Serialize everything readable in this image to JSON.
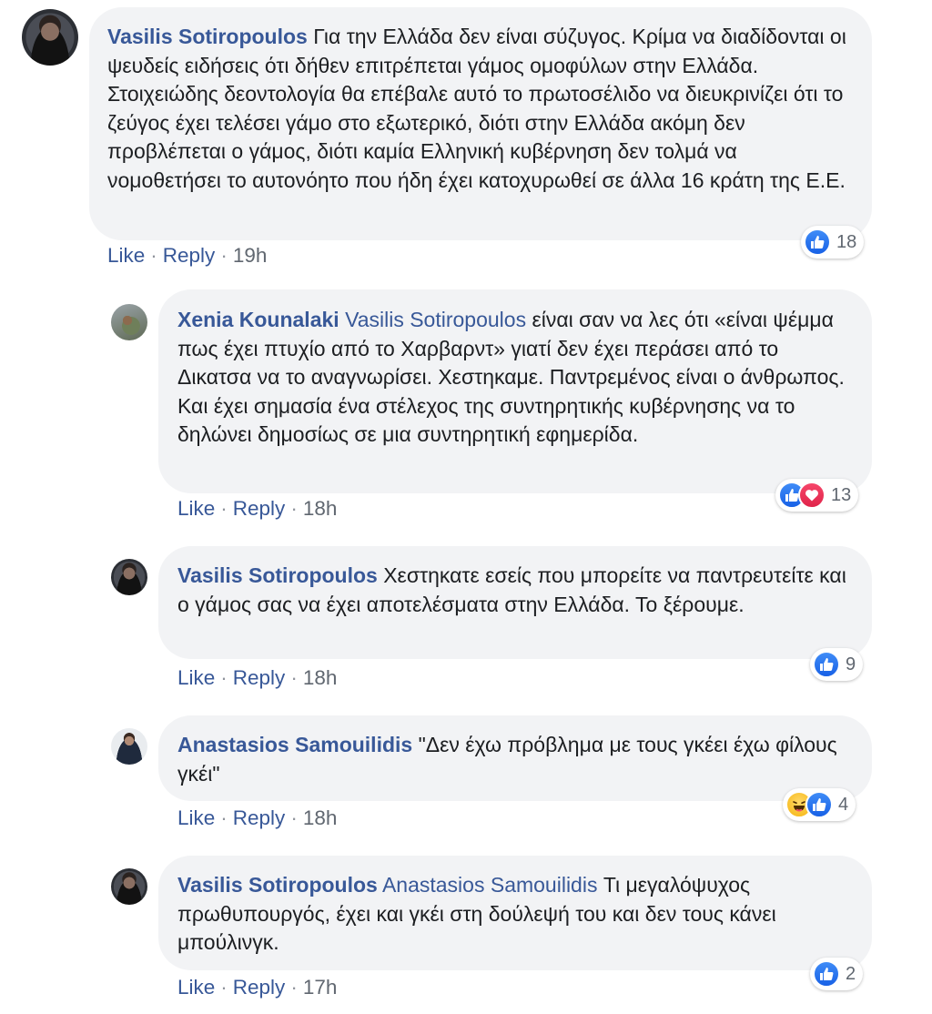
{
  "comments": [
    {
      "author": "Vasilis Sotiropoulos",
      "mention": "",
      "text": "Για την Ελλάδα δεν είναι σύζυγος. Κρίμα να διαδίδονται οι ψευδείς ειδήσεις ότι δήθεν επιτρέπεται γάμος ομοφύλων στην Ελλάδα. Στοιχειώδης δεοντολογία θα επέβαλε αυτό το πρωτοσέλιδο να διευκρινίζει ότι το ζεύγος έχει τελέσει γάμο στο εξωτερικό, διότι στην Ελλάδα ακόμη δεν προβλέπεται ο γάμος, διότι καμία Ελληνική κυβέρνηση δεν τολμά να νομοθετήσει το αυτονόητο που ήδη έχει κατοχυρωθεί σε άλλα 16 κράτη της Ε.Ε.",
      "like_label": "Like",
      "reply_label": "Reply",
      "time": "19h",
      "reactions": [
        "like"
      ],
      "reaction_count": "18"
    },
    {
      "author": "Xenia Kounalaki",
      "mention": "Vasilis Sotiropoulos",
      "text": "είναι σαν να λες ότι «είναι ψέμμα πως έχει πτυχίο από το Χαρβαρντ» γιατί δεν έχει περάσει από το Δικατσα να το αναγνωρίσει. Χεστηκαμε. Παντρεμένος είναι ο άνθρωπος. Και έχει σημασία ένα στέλεχος της συντηρητικής κυβέρνησης να το δηλώνει δημοσίως σε μια συντηρητική εφημερίδα.",
      "like_label": "Like",
      "reply_label": "Reply",
      "time": "18h",
      "reactions": [
        "like",
        "love"
      ],
      "reaction_count": "13"
    },
    {
      "author": "Vasilis Sotiropoulos",
      "mention": "",
      "text": "Χεστηκατε εσείς που μπορείτε να παντρευτείτε και ο γάμος σας να έχει αποτελέσματα στην Ελλάδα. Το ξέρουμε.",
      "like_label": "Like",
      "reply_label": "Reply",
      "time": "18h",
      "reactions": [
        "like"
      ],
      "reaction_count": "9"
    },
    {
      "author": "Anastasios Samouilidis",
      "mention": "",
      "text": "\"Δεν έχω πρόβλημα με τους γκέει έχω φίλους γκέι\"",
      "like_label": "Like",
      "reply_label": "Reply",
      "time": "18h",
      "reactions": [
        "haha",
        "like"
      ],
      "reaction_count": "4"
    },
    {
      "author": "Vasilis Sotiropoulos",
      "mention": "Anastasios Samouilidis",
      "text": "Τι μεγαλόψυχος πρωθυπουργός, έχει και γκέι στη δούλεψή του και δεν τους κάνει μπούλινγκ.",
      "like_label": "Like",
      "reply_label": "Reply",
      "time": "17h",
      "reactions": [
        "like"
      ],
      "reaction_count": "2"
    }
  ],
  "colors": {
    "link": "#385898",
    "bubble": "#f2f3f5",
    "like": "#1877f2",
    "love": "#f33e58"
  },
  "icons": {
    "like": "thumbs-up-icon",
    "love": "heart-icon",
    "haha": "laughing-face-icon"
  }
}
